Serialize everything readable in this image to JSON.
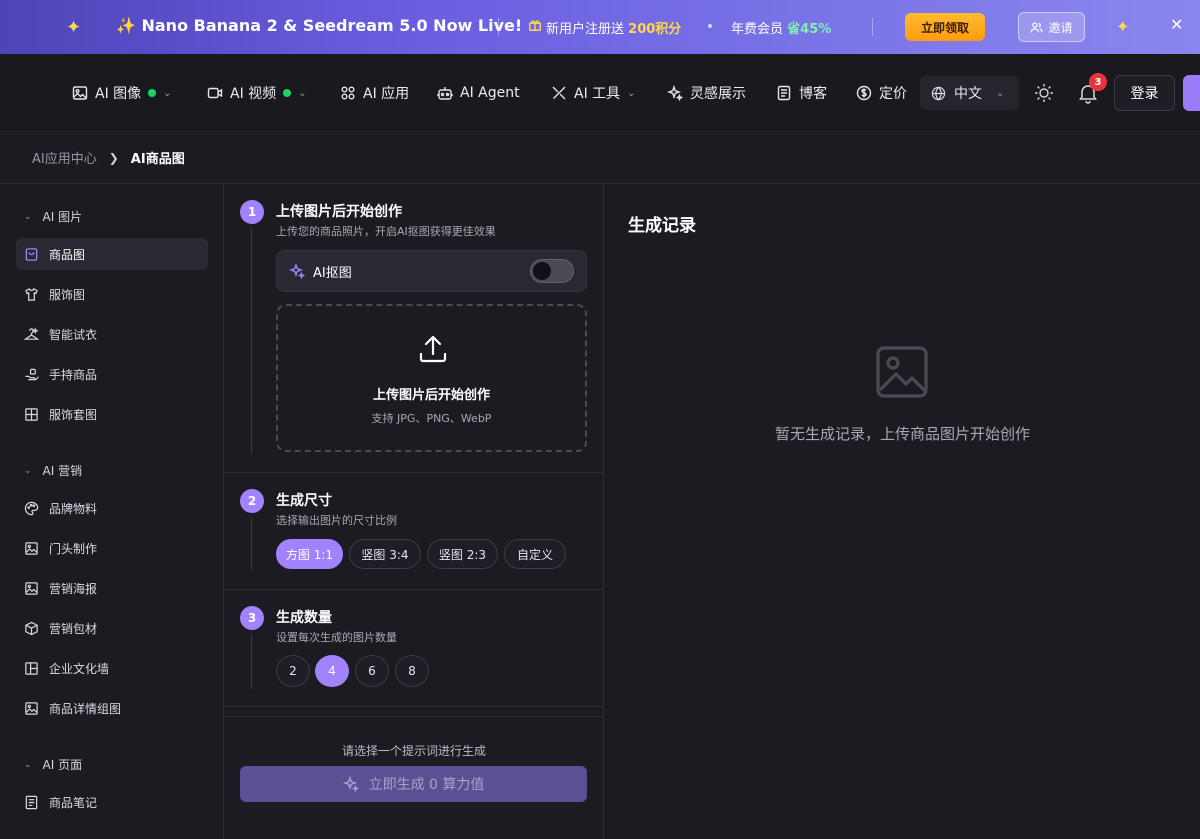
{
  "banner": {
    "headline": "✨ Nano Banana 2 & Seedream 5.0 Now Live!",
    "promo_new_user_prefix": "新用户注册送",
    "promo_new_user_points": "200积分",
    "promo_annual_prefix": "年费会员",
    "promo_annual_discount": "省45%",
    "claim_label": "立即领取",
    "invite_label": "邀请"
  },
  "nav": {
    "items": [
      {
        "label": "AI 图像"
      },
      {
        "label": "AI 视频"
      },
      {
        "label": "AI 应用"
      },
      {
        "label": "AI Agent"
      },
      {
        "label": "AI 工具"
      },
      {
        "label": "灵感展示"
      },
      {
        "label": "博客"
      },
      {
        "label": "定价"
      }
    ],
    "language": "中文",
    "notification_count": "3",
    "login_label": "登录"
  },
  "breadcrumb": {
    "parent": "AI应用中心",
    "current": "AI商品图"
  },
  "sidebar": {
    "sections": [
      {
        "title": "AI 图片",
        "items": [
          {
            "label": "商品图",
            "icon": "shopping-bag-icon",
            "active": true
          },
          {
            "label": "服饰图",
            "icon": "shirt-icon"
          },
          {
            "label": "智能试衣",
            "icon": "hanger-icon"
          },
          {
            "label": "手持商品",
            "icon": "hand-icon"
          },
          {
            "label": "服饰套图",
            "icon": "grid-icon"
          }
        ]
      },
      {
        "title": "AI 营销",
        "items": [
          {
            "label": "品牌物料",
            "icon": "palette-icon"
          },
          {
            "label": "门头制作",
            "icon": "image-icon"
          },
          {
            "label": "营销海报",
            "icon": "image-icon"
          },
          {
            "label": "营销包材",
            "icon": "box-icon"
          },
          {
            "label": "企业文化墙",
            "icon": "layout-icon"
          },
          {
            "label": "商品详情组图",
            "icon": "image-icon"
          }
        ]
      },
      {
        "title": "AI 页面",
        "items": [
          {
            "label": "商品笔记",
            "icon": "note-icon"
          }
        ]
      }
    ]
  },
  "steps": {
    "upload": {
      "number": "1",
      "title": "上传图片后开始创作",
      "subtitle": "上传您的商品照片，开启AI抠图获得更佳效果",
      "ai_cutout_label": "AI抠图",
      "ai_cutout_enabled": false,
      "drop_title": "上传图片后开始创作",
      "drop_formats": "支持 JPG、PNG、WebP"
    },
    "size": {
      "number": "2",
      "title": "生成尺寸",
      "subtitle": "选择输出图片的尺寸比例",
      "options": [
        "方图 1:1",
        "竖图 3:4",
        "竖图 2:3",
        "自定义"
      ],
      "selected": "方图 1:1"
    },
    "count": {
      "number": "3",
      "title": "生成数量",
      "subtitle": "设置每次生成的图片数量",
      "options": [
        "2",
        "4",
        "6",
        "8"
      ],
      "selected": "4"
    }
  },
  "generate": {
    "hint": "请选择一个提示词进行生成",
    "button_label": "立即生成 0 算力值"
  },
  "history": {
    "title": "生成记录",
    "empty_text": "暂无生成记录，上传商品图片开始创作"
  },
  "colors": {
    "accent": "#a183ff",
    "banner_highlight": "#ffd84a",
    "discount_highlight": "#7ff3b1",
    "claim_button": "#ffa51e",
    "status_dot": "#1ed760",
    "badge": "#e7333d"
  }
}
